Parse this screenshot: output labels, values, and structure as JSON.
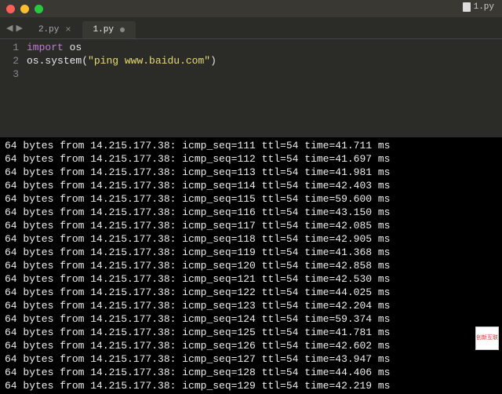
{
  "titlebar": {
    "filename": "1.py"
  },
  "tabs": [
    {
      "label": "2.py",
      "active": false,
      "dirty": false
    },
    {
      "label": "1.py",
      "active": true,
      "dirty": true
    }
  ],
  "code": {
    "line_numbers": [
      "1",
      "2",
      "3"
    ],
    "l1_kw": "import",
    "l1_mod": "os",
    "l2_obj": "os",
    "l2_fn": "system",
    "l2_str": "\"ping www.baidu.com\""
  },
  "terminal": {
    "prefix": "64 bytes from ",
    "ip": "14.215.177.38",
    "ttl": "54",
    "rows": [
      {
        "seq": "111",
        "time": "41.711"
      },
      {
        "seq": "112",
        "time": "41.697"
      },
      {
        "seq": "113",
        "time": "41.981"
      },
      {
        "seq": "114",
        "time": "42.403"
      },
      {
        "seq": "115",
        "time": "59.600"
      },
      {
        "seq": "116",
        "time": "43.150"
      },
      {
        "seq": "117",
        "time": "42.085"
      },
      {
        "seq": "118",
        "time": "42.905"
      },
      {
        "seq": "119",
        "time": "41.368"
      },
      {
        "seq": "120",
        "time": "42.858"
      },
      {
        "seq": "121",
        "time": "42.530"
      },
      {
        "seq": "122",
        "time": "44.025"
      },
      {
        "seq": "123",
        "time": "42.204"
      },
      {
        "seq": "124",
        "time": "59.374"
      },
      {
        "seq": "125",
        "time": "41.781"
      },
      {
        "seq": "126",
        "time": "42.602"
      },
      {
        "seq": "127",
        "time": "43.947"
      },
      {
        "seq": "128",
        "time": "44.406"
      },
      {
        "seq": "129",
        "time": "42.219"
      }
    ]
  },
  "watermark": "创新互联"
}
